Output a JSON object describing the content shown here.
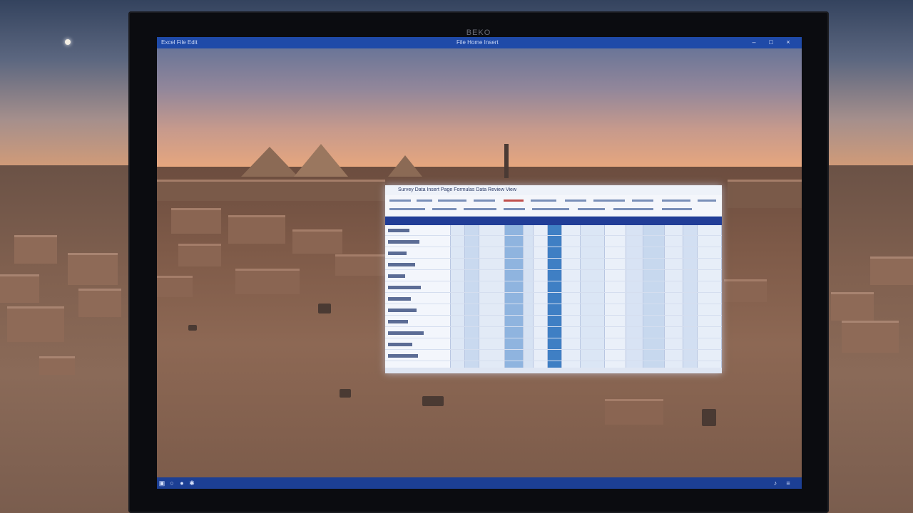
{
  "scene": {
    "description_colors": {
      "sky_top": "#34435e",
      "sky_horizon": "#d59c76",
      "sand": "#80604f",
      "monitor_bezel": "#0b0c10",
      "window_titlebar": "#1f4aa8",
      "taskbar": "#1c3f94",
      "sheet_header": "#213d97",
      "sheet_highlight_column": "#3f7fc4"
    }
  },
  "monitor": {
    "brand": "BEKO"
  },
  "window": {
    "title_left": "Excel  File Edit",
    "title_mid": "File  Home  Insert",
    "controls": [
      "minimize-icon",
      "maximize-icon",
      "close-icon"
    ]
  },
  "spreadsheet": {
    "title": "Survey Data  Insert  Page  Formulas  Data  Review  View"
  },
  "taskbar": {
    "icons": [
      "start-icon",
      "search-icon",
      "task-view-icon",
      "browser-icon"
    ],
    "tray": [
      "volume-icon",
      "network-icon"
    ]
  }
}
